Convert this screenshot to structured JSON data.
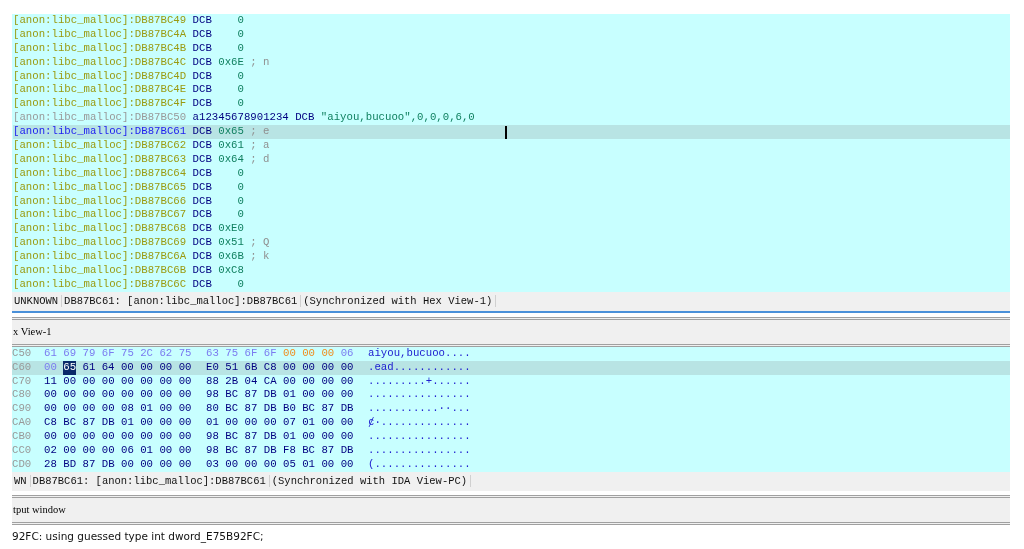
{
  "ida_view": {
    "rows": [
      {
        "kind": "byte",
        "address": "[anon:libc_malloc]:DB87BC49",
        "mnemonic": "DCB",
        "operand": "0",
        "selected": false
      },
      {
        "kind": "byte",
        "address": "[anon:libc_malloc]:DB87BC4A",
        "mnemonic": "DCB",
        "operand": "0",
        "selected": false
      },
      {
        "kind": "byte",
        "address": "[anon:libc_malloc]:DB87BC4B",
        "mnemonic": "DCB",
        "operand": "0",
        "selected": false
      },
      {
        "kind": "byte",
        "address": "[anon:libc_malloc]:DB87BC4C",
        "mnemonic": "DCB",
        "operand": "0x6E",
        "comment": "; n",
        "selected": false
      },
      {
        "kind": "byte",
        "address": "[anon:libc_malloc]:DB87BC4D",
        "mnemonic": "DCB",
        "operand": "0",
        "selected": false
      },
      {
        "kind": "byte",
        "address": "[anon:libc_malloc]:DB87BC4E",
        "mnemonic": "DCB",
        "operand": "0",
        "selected": false
      },
      {
        "kind": "byte",
        "address": "[anon:libc_malloc]:DB87BC4F",
        "mnemonic": "DCB",
        "operand": "0",
        "selected": false
      },
      {
        "kind": "label",
        "address": "[anon:libc_malloc]:DB87BC50",
        "label": "a12345678901234",
        "mnemonic": "DCB",
        "operand": "\"aiyou,bucuoo\",0,0,0,6,0",
        "selected": false
      },
      {
        "kind": "byte",
        "address": "[anon:libc_malloc]:DB87BC61",
        "mnemonic": "DCB",
        "operand": "0x65",
        "comment": "; e",
        "selected": true
      },
      {
        "kind": "byte",
        "address": "[anon:libc_malloc]:DB87BC62",
        "mnemonic": "DCB",
        "operand": "0x61",
        "comment": "; a",
        "selected": false
      },
      {
        "kind": "byte",
        "address": "[anon:libc_malloc]:DB87BC63",
        "mnemonic": "DCB",
        "operand": "0x64",
        "comment": "; d",
        "selected": false
      },
      {
        "kind": "byte",
        "address": "[anon:libc_malloc]:DB87BC64",
        "mnemonic": "DCB",
        "operand": "0",
        "selected": false
      },
      {
        "kind": "byte",
        "address": "[anon:libc_malloc]:DB87BC65",
        "mnemonic": "DCB",
        "operand": "0",
        "selected": false
      },
      {
        "kind": "byte",
        "address": "[anon:libc_malloc]:DB87BC66",
        "mnemonic": "DCB",
        "operand": "0",
        "selected": false
      },
      {
        "kind": "byte",
        "address": "[anon:libc_malloc]:DB87BC67",
        "mnemonic": "DCB",
        "operand": "0",
        "selected": false
      },
      {
        "kind": "byte",
        "address": "[anon:libc_malloc]:DB87BC68",
        "mnemonic": "DCB",
        "operand": "0xE0",
        "selected": false
      },
      {
        "kind": "byte",
        "address": "[anon:libc_malloc]:DB87BC69",
        "mnemonic": "DCB",
        "operand": "0x51",
        "comment": "; Q",
        "selected": false
      },
      {
        "kind": "byte",
        "address": "[anon:libc_malloc]:DB87BC6A",
        "mnemonic": "DCB",
        "operand": "0x6B",
        "comment": "; k",
        "selected": false
      },
      {
        "kind": "byte",
        "address": "[anon:libc_malloc]:DB87BC6B",
        "mnemonic": "DCB",
        "operand": "0xC8",
        "selected": false
      },
      {
        "kind": "byte",
        "address": "[anon:libc_malloc]:DB87BC6C",
        "mnemonic": "DCB",
        "operand": "0",
        "selected": false
      }
    ],
    "status": {
      "mode": "UNKNOWN",
      "location": "DB87BC61: [anon:libc_malloc]:DB87BC61",
      "sync": "(Synchronized with Hex View-1)"
    }
  },
  "hex_view": {
    "title": "x View-1",
    "rows": [
      {
        "offset": "C50",
        "left": [
          {
            "text": "61 69 79 6F 75 2C 62 75",
            "kind": "str"
          }
        ],
        "right": [
          {
            "text": "63 75 6F 6F",
            "kind": "str"
          },
          {
            "text": "00 00 00",
            "kind": "zero"
          },
          {
            "text": "06",
            "kind": "str"
          }
        ],
        "ascii": "aiyou,bucuoo....",
        "selected": false
      },
      {
        "offset": "C60",
        "left": [
          {
            "text": "00",
            "kind": "str"
          },
          {
            "text": "65",
            "kind": "cursor"
          },
          {
            "text": "61 64 00 00 00 00",
            "kind": "normal"
          }
        ],
        "right": [
          {
            "text": "E0 51 6B C8 00 00 00 00",
            "kind": "normal"
          }
        ],
        "ascii": ".ead............",
        "selected": true
      },
      {
        "offset": "C70",
        "left": [
          {
            "text": "11 00 00 00 00 00 00 00",
            "kind": "normal"
          }
        ],
        "right": [
          {
            "text": "88 2B 04 CA 00 00 00 00",
            "kind": "normal"
          }
        ],
        "ascii": ".........+......",
        "selected": false
      },
      {
        "offset": "C80",
        "left": [
          {
            "text": "00 00 00 00 00 00 00 00",
            "kind": "normal"
          }
        ],
        "right": [
          {
            "text": "98 BC 87 DB 01 00 00 00",
            "kind": "normal"
          }
        ],
        "ascii": "................",
        "selected": false
      },
      {
        "offset": "C90",
        "left": [
          {
            "text": "00 00 00 00 08 01 00 00",
            "kind": "normal"
          }
        ],
        "right": [
          {
            "text": "80 BC 87 DB B0 BC 87 DB",
            "kind": "normal"
          }
        ],
        "ascii": "...........··...",
        "selected": false
      },
      {
        "offset": "CA0",
        "left": [
          {
            "text": "C8 BC 87 DB 01 00 00 00",
            "kind": "normal"
          }
        ],
        "right": [
          {
            "text": "01 00 00 00 07 01 00 00",
            "kind": "normal"
          }
        ],
        "ascii": "ȼ·..............",
        "selected": false
      },
      {
        "offset": "CB0",
        "left": [
          {
            "text": "00 00 00 00 00 00 00 00",
            "kind": "normal"
          }
        ],
        "right": [
          {
            "text": "98 BC 87 DB 01 00 00 00",
            "kind": "normal"
          }
        ],
        "ascii": "................",
        "selected": false
      },
      {
        "offset": "CC0",
        "left": [
          {
            "text": "02 00 00 00 06 01 00 00",
            "kind": "normal"
          }
        ],
        "right": [
          {
            "text": "98 BC 87 DB F8 BC 87 DB",
            "kind": "normal"
          }
        ],
        "ascii": "................",
        "selected": false
      },
      {
        "offset": "CD0",
        "left": [
          {
            "text": "28 BD 87 DB 00 00 00 00",
            "kind": "normal"
          }
        ],
        "right": [
          {
            "text": "03 00 00 00 05 01 00 00",
            "kind": "normal"
          }
        ],
        "ascii": "(...............",
        "selected": false
      }
    ],
    "status": {
      "mode": "WN",
      "location": "DB87BC61: [anon:libc_malloc]:DB87BC61",
      "sync": "(Synchronized with IDA View-PC)"
    }
  },
  "output_window": {
    "title": "tput window",
    "lines": [
      "92FC: using guessed type int dword_E75B92FC;"
    ]
  }
}
